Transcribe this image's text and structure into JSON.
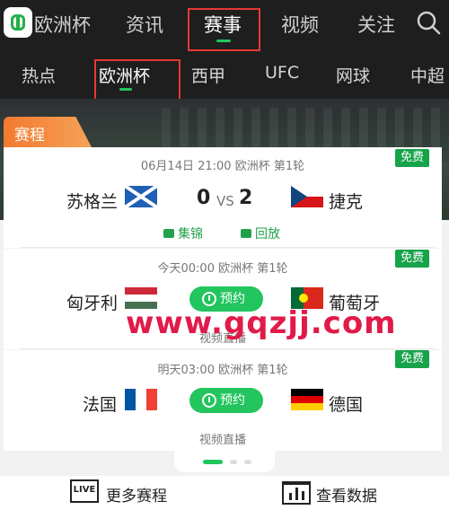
{
  "top_nav": {
    "logo_text": "欧洲杯",
    "tabs": [
      "资讯",
      "赛事",
      "视频",
      "关注"
    ]
  },
  "sub_nav": {
    "tabs": [
      "热点",
      "欧洲杯",
      "西甲",
      "UFC",
      "网球",
      "中超"
    ]
  },
  "schedule_label": "赛程",
  "matches": [
    {
      "info": "06月14日 21:00 欧洲杯 第1轮",
      "home": "苏格兰",
      "away": "捷克",
      "home_score": "0",
      "vs": "VS",
      "away_score": "2",
      "badge": "免费",
      "links": [
        "集锦",
        "回放"
      ]
    },
    {
      "info": "今天00:00 欧洲杯 第1轮",
      "home": "匈牙利",
      "away": "葡萄牙",
      "badge": "免费",
      "action": "预约",
      "footer": "视频直播"
    },
    {
      "info": "明天03:00 欧洲杯 第1轮",
      "home": "法国",
      "away": "德国",
      "badge": "免费",
      "action": "预约",
      "footer": "视频直播"
    }
  ],
  "watermark": "www.gqzjj.com",
  "bottom": {
    "live_icon_text": "LIVE",
    "more_schedule": "更多赛程",
    "view_data": "查看数据"
  },
  "colors": {
    "accent_green": "#22c55e",
    "header_bg": "#1e1e1e",
    "schedule_orange": "#f27a2e",
    "highlight_red": "#e53935"
  }
}
